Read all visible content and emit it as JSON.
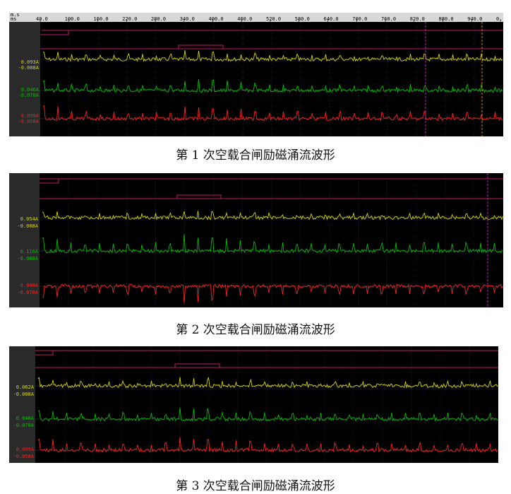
{
  "figures": [
    {
      "caption": "第 1 次空载合闸励磁涌流波形",
      "axis": {
        "unit_top": "m.s",
        "unit_bottom": "ms",
        "ticks": [
          "40.0",
          "100.0",
          "160.0",
          "220.0",
          "280.0",
          "340.0",
          "400.0",
          "460.0",
          "520.0",
          "580.0",
          "640.0",
          "700.0",
          "760.0",
          "820.0",
          "880.0",
          "940.0",
          "0."
        ]
      },
      "channels": [
        {
          "max_label": "0.093A",
          "min_label": "-0.008A",
          "color": "#d6d600"
        },
        {
          "max_label": "0.046A",
          "min_label": "-0.070A",
          "color": "#00c000"
        },
        {
          "max_label": "0.099A",
          "min_label": "-0.058A",
          "color": "#ff2020"
        }
      ]
    },
    {
      "caption": "第 2 次空载合闸励磁涌流波形",
      "channels": [
        {
          "max_label": "0.054A",
          "min_label": "-0.008A",
          "color": "#d6d600"
        },
        {
          "max_label": "0.116A",
          "min_label": "-0.008A",
          "color": "#00c000"
        },
        {
          "max_label": "0.000A",
          "min_label": "-0.070A",
          "color": "#ff2020"
        }
      ]
    },
    {
      "caption": "第 3 次空载合闸励磁涌流波形",
      "channels": [
        {
          "max_label": "0.062A",
          "min_label": "-0.008A",
          "color": "#d6d600"
        },
        {
          "max_label": "0.046A",
          "min_label": "-0.070A",
          "color": "#00c000"
        },
        {
          "max_label": "0.099A",
          "min_label": "-0.058A",
          "color": "#ff2020"
        }
      ]
    }
  ],
  "chart_data": [
    {
      "type": "line",
      "title": "第 1 次空载合闸励磁涌流波形",
      "xlabel": "ms",
      "xlim": [
        40,
        960
      ],
      "series": [
        {
          "values": []
        },
        {
          "values": []
        },
        {
          "values": []
        }
      ]
    },
    {
      "type": "line",
      "title": "第 2 次空载合闸励磁涌流波形",
      "series": [
        {
          "values": []
        },
        {
          "values": []
        },
        {
          "values": []
        }
      ]
    },
    {
      "type": "line",
      "title": "第 3 次空载合闸励磁涌流波形",
      "series": [
        {
          "values": []
        },
        {
          "values": []
        },
        {
          "values": []
        }
      ]
    }
  ],
  "colors": {
    "panel_bg": "#000000",
    "status_line": "#c0186a",
    "grid": "#5a5a5a",
    "cursor_magenta": "#c020c0",
    "cursor_orange": "#e08000",
    "label_bg": "#2a2a2a"
  }
}
